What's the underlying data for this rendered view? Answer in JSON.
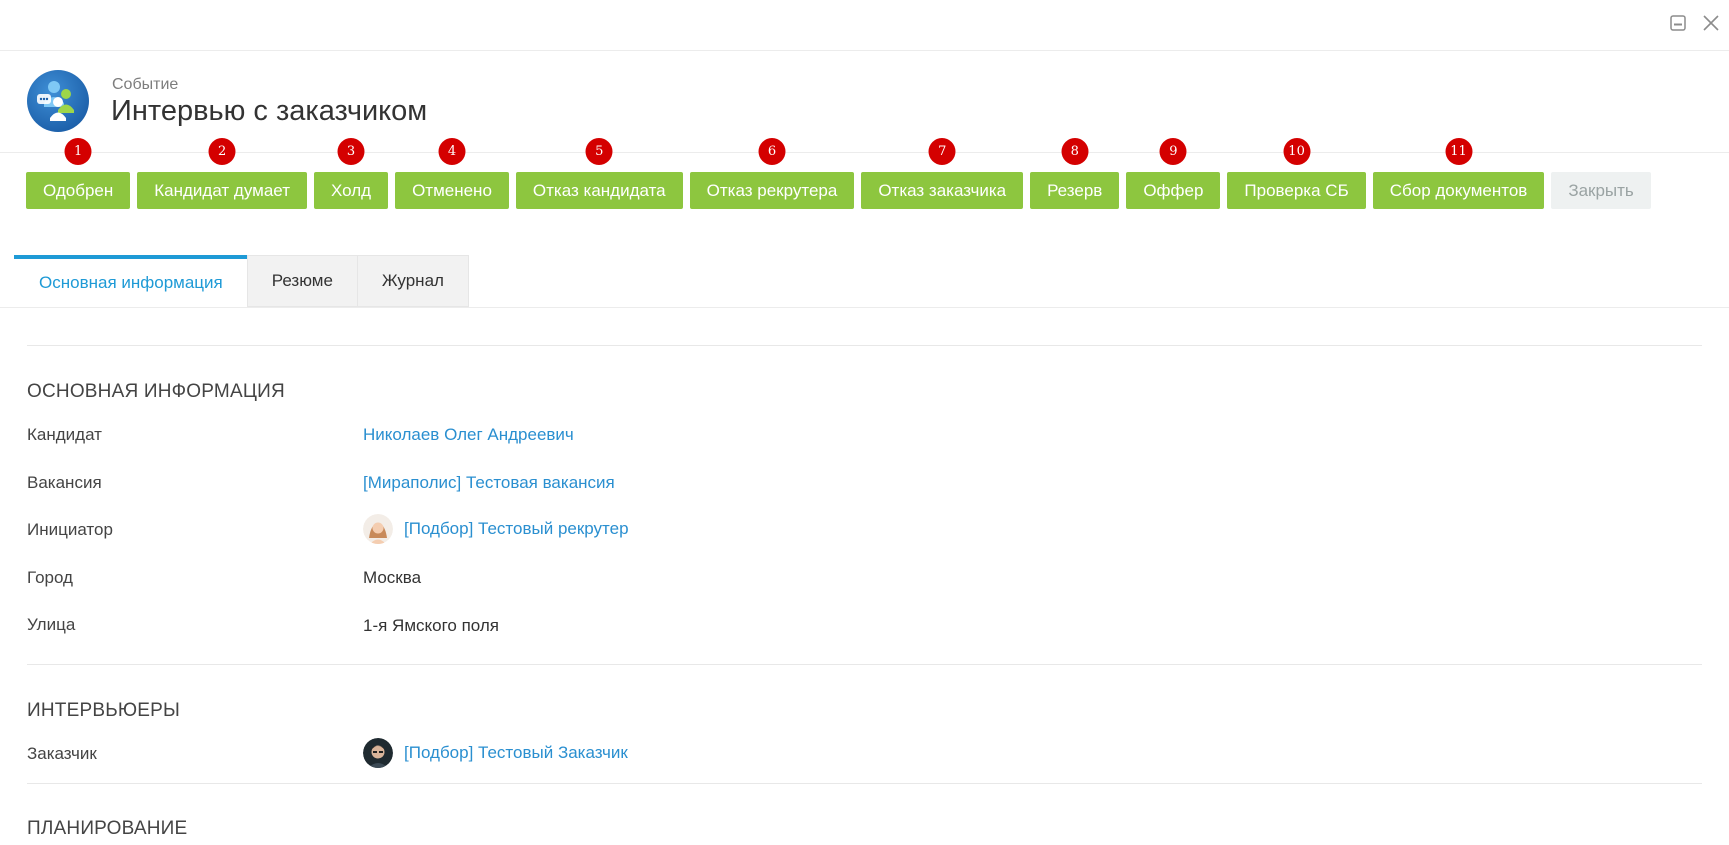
{
  "window": {
    "minimize_icon": "minimize-icon",
    "close_icon": "close-icon"
  },
  "header": {
    "subtitle": "Событие",
    "title": "Интервью с заказчиком",
    "icon": "event-people-icon"
  },
  "actions": [
    {
      "badge": "1",
      "label": "Одобрен"
    },
    {
      "badge": "2",
      "label": "Кандидат думает"
    },
    {
      "badge": "3",
      "label": "Холд"
    },
    {
      "badge": "4",
      "label": "Отменено"
    },
    {
      "badge": "5",
      "label": "Отказ кандидата"
    },
    {
      "badge": "6",
      "label": "Отказ рекрутера"
    },
    {
      "badge": "7",
      "label": "Отказ заказчика"
    },
    {
      "badge": "8",
      "label": "Резерв"
    },
    {
      "badge": "9",
      "label": "Оффер"
    },
    {
      "badge": "10",
      "label": "Проверка СБ"
    },
    {
      "badge": "11",
      "label": "Сбор документов"
    }
  ],
  "close_button": "Закрыть",
  "tabs": [
    {
      "label": "Основная информация",
      "active": true
    },
    {
      "label": "Резюме"
    },
    {
      "label": "Журнал"
    }
  ],
  "sections": {
    "main": {
      "title": "ОСНОВНАЯ ИНФОРМАЦИЯ",
      "rows": [
        {
          "label": "Кандидат",
          "value": "Николаев Олег Андреевич"
        },
        {
          "label": "Вакансия",
          "value": "[Мираполис] Тестовая вакансия"
        },
        {
          "label": "Инициатор",
          "value": "[Подбор] Тестовый рекрутер"
        },
        {
          "label": "Город",
          "value": "Москва"
        },
        {
          "label": "Улица",
          "value": "1-я Ямского поля"
        }
      ]
    },
    "interviewers": {
      "title": "ИНТЕРВЬЮЕРЫ",
      "rows": [
        {
          "label": "Заказчик",
          "value": "[Подбор] Тестовый Заказчик"
        }
      ]
    },
    "planning": {
      "title": "ПЛАНИРОВАНИЕ"
    }
  },
  "colors": {
    "accent_green": "#8dc63f",
    "badge_red": "#d40000",
    "link_blue": "#2a8fd0",
    "tab_active_blue": "#1e9ad6"
  }
}
